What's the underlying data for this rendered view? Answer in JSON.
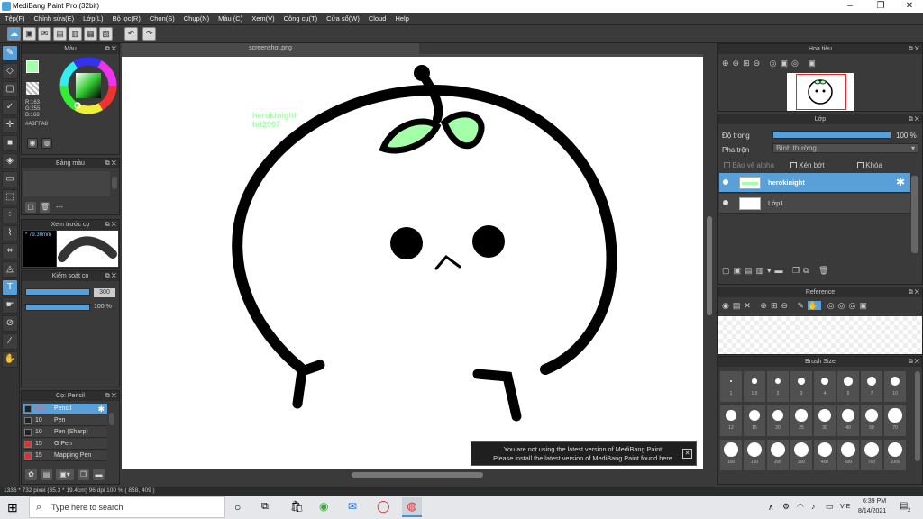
{
  "window": {
    "title": "MediBang Paint Pro (32bit)",
    "minimize": "–",
    "maximize": "❐",
    "close": "✕"
  },
  "menu": [
    "Tệp(F)",
    "Chỉnh sửa(E)",
    "Lớp(L)",
    "Bộ lọc(R)",
    "Chọn(S)",
    "Chụp(N)",
    "Màu (C)",
    "Xem(V)",
    "Công cụ(T)",
    "Cửa sổ(W)",
    "Cloud",
    "Help"
  ],
  "document": {
    "tab": "screenshot.png"
  },
  "canvas_text": {
    "line1": "herokinight",
    "line2": "hd2007"
  },
  "color_panel": {
    "title": "Màu",
    "r": "R:163",
    "g": "G:255",
    "b": "B:168",
    "hex": "#A3FFA8",
    "accent": "#A3FFA8"
  },
  "palette": {
    "title": "Bảng màu",
    "dash": "---"
  },
  "brush_preview": {
    "title": "Xem trước cọ",
    "size": "79.30mm"
  },
  "brush_control": {
    "title": "Kiểm soát cọ",
    "size_val": "300",
    "opacity_val": "100 %"
  },
  "brush_list": {
    "title": "Cọ: Pencil",
    "items": [
      {
        "size": "300",
        "name": "Pencil",
        "color": "#222222",
        "selected": true
      },
      {
        "size": "10",
        "name": "Pen",
        "color": "#222222",
        "selected": false
      },
      {
        "size": "10",
        "name": "Pen (Sharp)",
        "color": "#222222",
        "selected": false
      },
      {
        "size": "15",
        "name": "G Pen",
        "color": "#e03030",
        "selected": false
      },
      {
        "size": "15",
        "name": "Mapping Pen",
        "color": "#e03030",
        "selected": false
      }
    ]
  },
  "navigator": {
    "title": "Hoa tiêu"
  },
  "layers": {
    "title": "Lớp",
    "opacity_label": "Độ trong",
    "opacity_val": "100 %",
    "blend_label": "Pha trộn",
    "blend_val": "Bình thường",
    "protect_alpha": "Bảo vệ alpha",
    "clipping": "Xén bớt",
    "lock": "Khóa",
    "items": [
      {
        "name": "herokinight",
        "selected": true
      },
      {
        "name": "Lớp1",
        "selected": false
      }
    ]
  },
  "reference": {
    "title": "Reference"
  },
  "brush_size": {
    "title": "Brush Size",
    "sizes": [
      "1",
      "1.5",
      "2",
      "3",
      "4",
      "5",
      "7",
      "10",
      "12",
      "15",
      "20",
      "25",
      "30",
      "40",
      "50",
      "70",
      "100",
      "150",
      "200",
      "300",
      "400",
      "500",
      "700",
      "1000"
    ]
  },
  "notice": {
    "line1": "You are not using the latest version of MediBang Paint.",
    "line2": "Please install the latest version of MediBang Paint found here.",
    "close": "✕"
  },
  "status": {
    "text": "1336 * 732 pixel  (35.3 * 19.4cm)  96 dpi  100 %  ( 858, 409 )"
  },
  "taskbar": {
    "search": "Type here to search",
    "lang": "VIE",
    "time": "6:39 PM",
    "date": "8/14/2021",
    "notif": "2"
  }
}
